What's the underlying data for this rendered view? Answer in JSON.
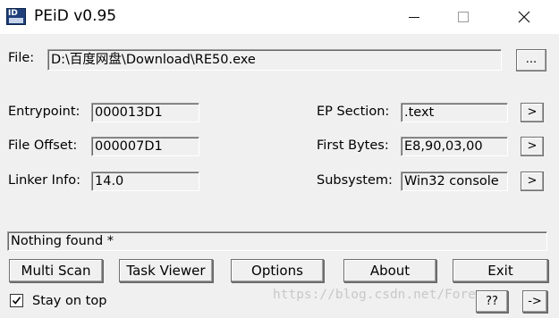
{
  "window": {
    "title": "PEiD v0.95",
    "icon_name": "peid-app-icon",
    "icon_text": "ID"
  },
  "file": {
    "label": "File:",
    "path": "D:\\百度网盘\\Download\\RE50.exe",
    "browse_label": "..."
  },
  "info": {
    "entrypoint_label": "Entrypoint:",
    "entrypoint_value": "000013D1",
    "file_offset_label": "File Offset:",
    "file_offset_value": "000007D1",
    "linker_info_label": "Linker Info:",
    "linker_info_value": "14.0",
    "ep_section_label": "EP Section:",
    "ep_section_value": ".text",
    "first_bytes_label": "First Bytes:",
    "first_bytes_value": "E8,90,03,00",
    "subsystem_label": "Subsystem:",
    "subsystem_value": "Win32 console",
    "more_label": ">"
  },
  "status": {
    "text": "Nothing found *"
  },
  "buttons": {
    "multi_scan": "Multi Scan",
    "task_viewer": "Task Viewer",
    "options": "Options",
    "about": "About",
    "exit": "Exit",
    "help": "??",
    "arrow": "->"
  },
  "stay_on_top": {
    "label": "Stay on top",
    "checked": true
  },
  "watermark": "https://blog.csdn.net/Forever_"
}
